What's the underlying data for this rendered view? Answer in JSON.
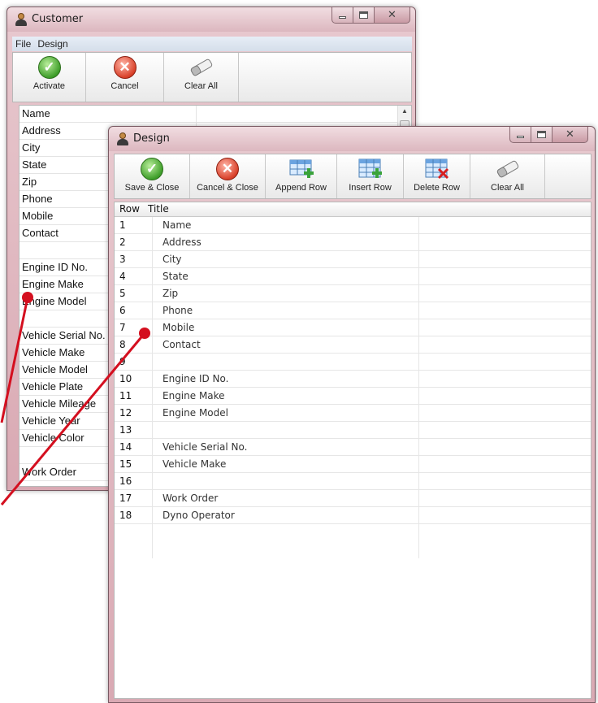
{
  "customer_window": {
    "title": "Customer",
    "menu": [
      "File",
      "Design"
    ],
    "toolbar": [
      {
        "label": "Activate",
        "icon": "check-icon"
      },
      {
        "label": "Cancel",
        "icon": "x-icon"
      },
      {
        "label": "Clear All",
        "icon": "eraser-icon"
      }
    ],
    "fields": [
      "Name",
      "Address",
      "City",
      "State",
      "Zip",
      "Phone",
      "Mobile",
      "Contact",
      "",
      "Engine ID No.",
      "Engine Make",
      "Engine Model",
      "",
      "Vehicle Serial No.",
      "Vehicle Make",
      "Vehicle Model",
      "Vehicle Plate",
      "Vehicle Mileage",
      "Vehicle Year",
      "Vehicle Color",
      "",
      "Work Order"
    ]
  },
  "design_window": {
    "title": "Design",
    "toolbar": [
      {
        "label": "Save & Close",
        "icon": "check-icon"
      },
      {
        "label": "Cancel & Close",
        "icon": "x-icon"
      },
      {
        "label": "Append Row",
        "icon": "append-row-icon"
      },
      {
        "label": "Insert Row",
        "icon": "insert-row-icon"
      },
      {
        "label": "Delete Row",
        "icon": "delete-row-icon"
      },
      {
        "label": "Clear All",
        "icon": "eraser-icon"
      }
    ],
    "grid_headers": {
      "row": "Row",
      "title": "Title"
    },
    "rows": [
      {
        "row": "1",
        "title": "Name"
      },
      {
        "row": "2",
        "title": "Address"
      },
      {
        "row": "3",
        "title": "City"
      },
      {
        "row": "4",
        "title": "State"
      },
      {
        "row": "5",
        "title": "Zip"
      },
      {
        "row": "6",
        "title": "Phone"
      },
      {
        "row": "7",
        "title": "Mobile"
      },
      {
        "row": "8",
        "title": "Contact"
      },
      {
        "row": "9",
        "title": ""
      },
      {
        "row": "10",
        "title": "Engine ID No."
      },
      {
        "row": "11",
        "title": "Engine Make"
      },
      {
        "row": "12",
        "title": "Engine Model"
      },
      {
        "row": "13",
        "title": ""
      },
      {
        "row": "14",
        "title": "Vehicle Serial No."
      },
      {
        "row": "15",
        "title": "Vehicle Make"
      },
      {
        "row": "16",
        "title": ""
      },
      {
        "row": "17",
        "title": "Work Order"
      },
      {
        "row": "18",
        "title": "Dyno Operator"
      }
    ]
  },
  "colors": {
    "pointer": "#d40f1f",
    "window_frame": "#d9a9b3"
  }
}
